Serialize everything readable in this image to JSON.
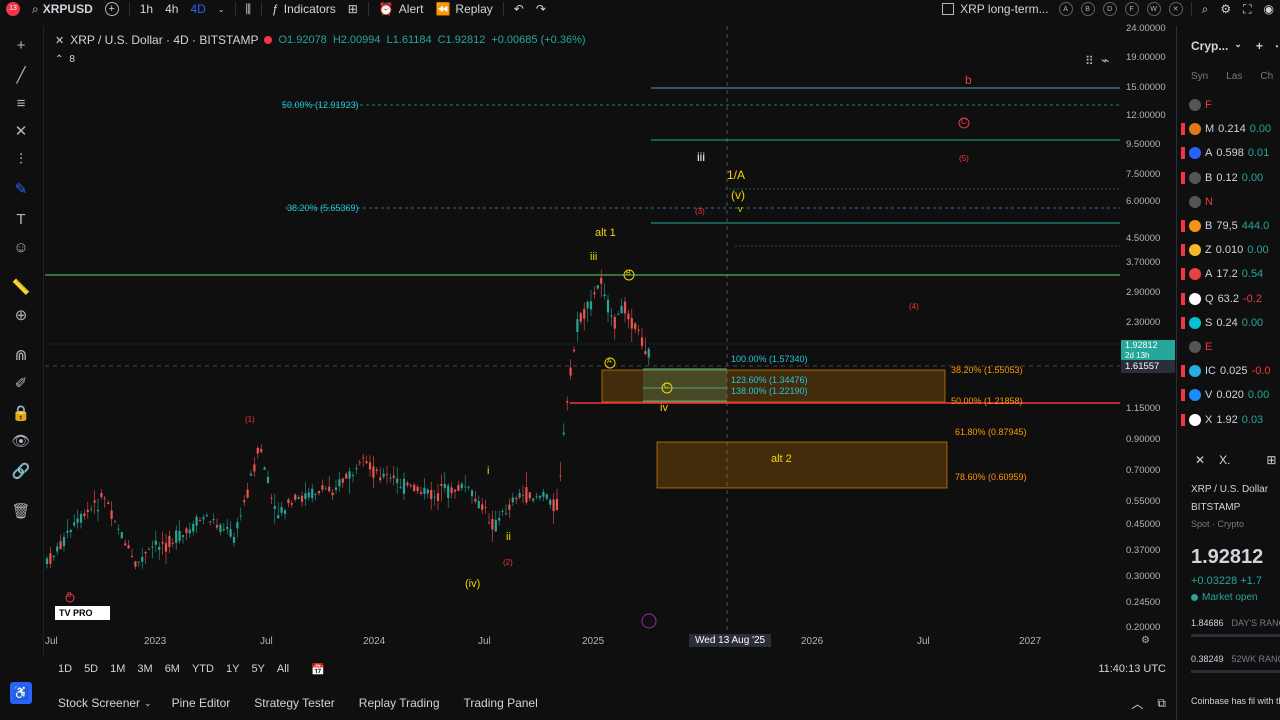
{
  "topbar": {
    "symbol": "XRPUSD",
    "intervals": [
      "1h",
      "4h",
      "4D"
    ],
    "active_interval": "4D",
    "indicators": "Indicators",
    "alert": "Alert",
    "replay": "Replay",
    "layout_name": "XRP long-term...",
    "letter_buttons": [
      "A",
      "B",
      "D",
      "F",
      "W"
    ],
    "notification_count": "13"
  },
  "chart": {
    "title": "XRP / U.S. Dollar · 4D · BITSTAMP",
    "ohlc": {
      "o": "O1.92078",
      "h": "H2.00994",
      "l": "L1.61184",
      "c": "C1.92812",
      "chg": "+0.00685 (+0.36%)"
    },
    "indicator_count": "8",
    "fib_labels": {
      "f50": "50.00% (12.91923)",
      "f382": "38.20% (5.65369)",
      "f100": "100.00% (1.57340)",
      "f1236": "123.60% (1.34476)",
      "f138": "138.00% (1.22190)",
      "r382": "38.20% (1.55053)",
      "r50": "50.00% (1.21858)",
      "r618": "61.80% (0.87945)",
      "r786": "78.60% (0.60959)"
    },
    "waves": {
      "b_red": "b",
      "c_red": "C",
      "five": "(5)",
      "four": "(4)",
      "three": "(3)",
      "one_red": "(1)",
      "two_red": "(2)",
      "iii_top": "iii",
      "one_a": "1/A",
      "v_paren": "(v)",
      "v_small": "v",
      "alt1": "alt 1",
      "iii_small": "iii",
      "b_circle": "B",
      "a_circle": "A",
      "c_circle": "C",
      "iv": "iv",
      "i": "i",
      "ii": "ii",
      "iv_paren": "(iv)",
      "alt2": "alt 2",
      "b_bottom": "B"
    },
    "current_price": "1.92812",
    "price_countdown": "2d 13h",
    "crosshair_price": "1.61557",
    "crosshair_date": "Wed 13 Aug '25",
    "colors": {
      "up": "#26a69a",
      "down": "#ef5350",
      "accent": "#2962ff",
      "green_line": "#4caf50",
      "red_line": "#f23645"
    }
  },
  "price_scale": [
    "24.00000",
    "19.00000",
    "15.00000",
    "12.00000",
    "9.50000",
    "7.50000",
    "6.00000",
    "4.50000",
    "3.70000",
    "2.90000",
    "2.30000",
    "1.15000",
    "0.90000",
    "0.70000",
    "0.55000",
    "0.45000",
    "0.37000",
    "0.30000",
    "0.24500",
    "0.20000"
  ],
  "time_scale": [
    "Jul",
    "2023",
    "Jul",
    "2024",
    "Jul",
    "2025",
    "2026",
    "Jul",
    "2027"
  ],
  "bottombar": {
    "timeframes": [
      "1D",
      "5D",
      "1M",
      "3M",
      "6M",
      "YTD",
      "1Y",
      "5Y",
      "All"
    ],
    "clock": "11:40:13 UTC"
  },
  "bottomtabs": [
    "Stock Screener",
    "Pine Editor",
    "Strategy Tester",
    "Replay Trading",
    "Trading Panel"
  ],
  "watchlist": {
    "title": "Cryp...",
    "columns": [
      "Syn",
      "Las",
      "Ch"
    ],
    "rows": [
      {
        "sym": "F",
        "last": "",
        "chg": "",
        "color": "#555555",
        "section": true
      },
      {
        "sym": "M",
        "last": "0.214",
        "chg": "0.00",
        "color": "#e2761b"
      },
      {
        "sym": "A",
        "last": "0.598",
        "chg": "0.01",
        "color": "#2962ff"
      },
      {
        "sym": "B",
        "last": "0.12",
        "chg": "0.00",
        "color": "#555555"
      },
      {
        "sym": "N",
        "last": "",
        "chg": "",
        "color": "#555555",
        "section": true
      },
      {
        "sym": "B",
        "last": "79,5",
        "chg": "444.0",
        "color": "#f7931a"
      },
      {
        "sym": "Z",
        "last": "0.010",
        "chg": "0.00",
        "color": "#f4b728"
      },
      {
        "sym": "A",
        "last": "17.2",
        "chg": "0.54",
        "color": "#e84142"
      },
      {
        "sym": "Q",
        "last": "63.2",
        "chg": "-0.2",
        "color": "#ffffff"
      },
      {
        "sym": "S",
        "last": "0.24",
        "chg": "0.00",
        "color": "#00c4d1"
      },
      {
        "sym": "E",
        "last": "",
        "chg": "",
        "color": "#555555",
        "section": true
      },
      {
        "sym": "IC",
        "last": "0.025",
        "chg": "-0.0",
        "color": "#29abe2"
      },
      {
        "sym": "V",
        "last": "0.020",
        "chg": "0.00",
        "color": "#1a8cff"
      },
      {
        "sym": "X",
        "last": "1.92",
        "chg": "0.03",
        "color": "#ffffff"
      }
    ],
    "detail": {
      "name": "XRP / U.S. Dollar",
      "exchange": "BITSTAMP",
      "type": "Spot · Crypto",
      "price": "1.92812",
      "change": "+0.03228 +1.7",
      "status": "Market open",
      "day_range_low": "1.84686",
      "day_range_label": "DAY'S RANG",
      "week52_low": "0.38249",
      "week52_label": "52WK RANG",
      "news": "Coinbase has fil with the CFTC to s"
    }
  }
}
